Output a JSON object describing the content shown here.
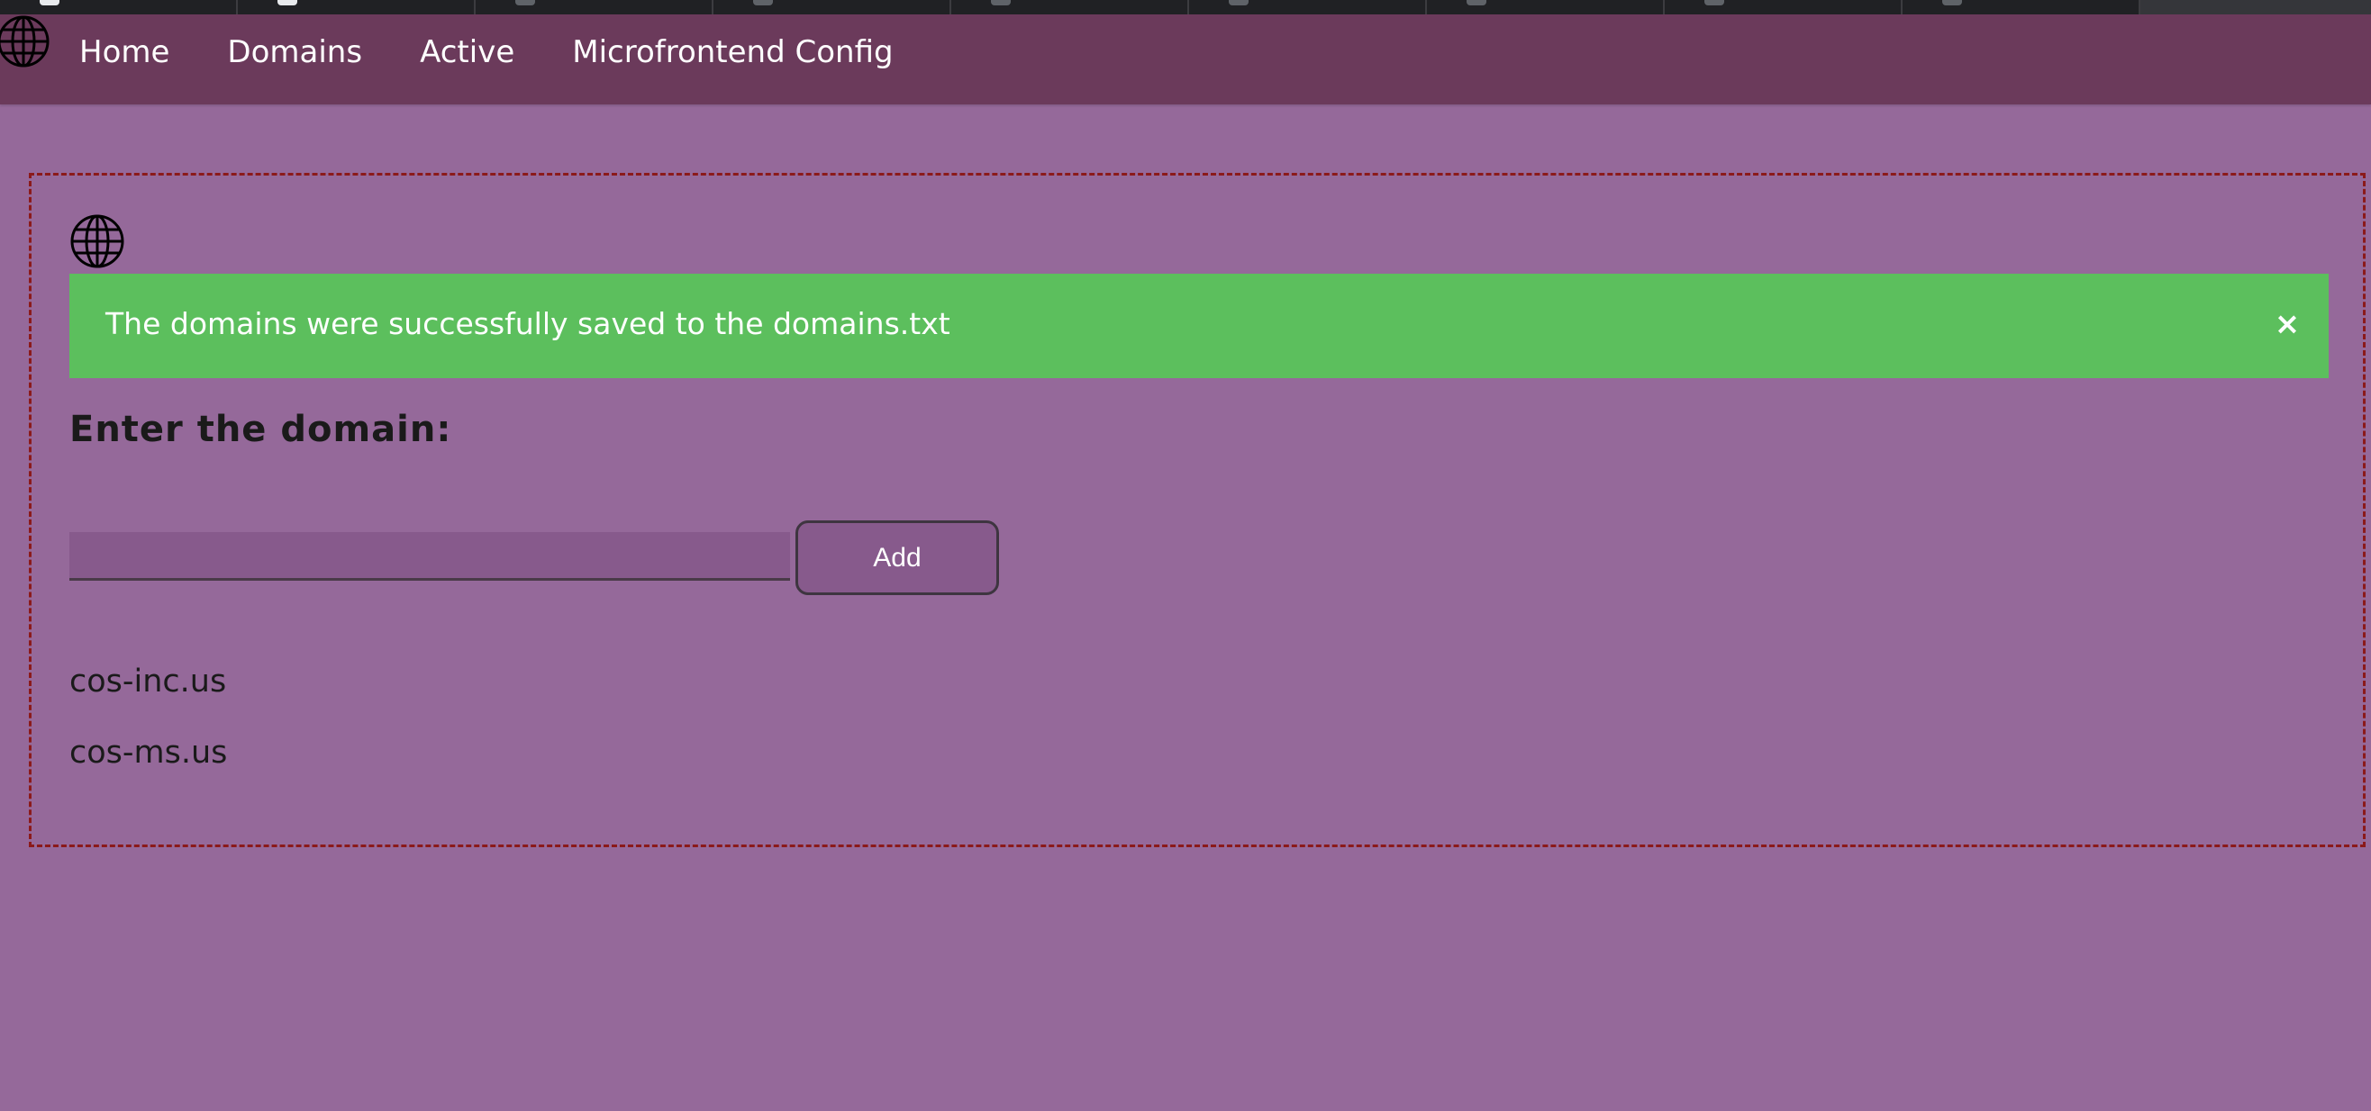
{
  "navbar": {
    "links": [
      {
        "label": "Home"
      },
      {
        "label": "Domains"
      },
      {
        "label": "Active"
      },
      {
        "label": "Microfrontend Config"
      }
    ]
  },
  "alert": {
    "message": "The domains were successfully saved to the domains.txt",
    "close_symbol": "×",
    "color": "#5cbf5d"
  },
  "form": {
    "label": "Enter the domain:",
    "input_value": "",
    "add_button_label": "Add"
  },
  "domains": [
    {
      "name": "cos-inc.us"
    },
    {
      "name": "cos-ms.us"
    }
  ],
  "icons": {
    "nav_logo": "globe-icon",
    "content_logo": "globe-icon",
    "alert_close": "close-icon"
  },
  "colors": {
    "page_background": "#95699a",
    "navbar_background": "#6b3a5b",
    "container_border": "#8b1a1a"
  }
}
